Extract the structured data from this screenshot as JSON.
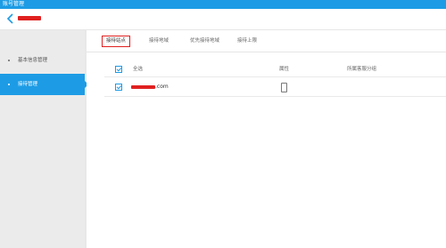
{
  "window": {
    "title": "账号管理"
  },
  "sidebar": {
    "items": [
      {
        "label": "基本信息管理"
      },
      {
        "label": "接待管理"
      }
    ]
  },
  "tabs": [
    {
      "label": "接待站点"
    },
    {
      "label": "接待地域"
    },
    {
      "label": "优先接待地域"
    },
    {
      "label": "接待上限"
    }
  ],
  "table": {
    "headers": {
      "select_all": "全选",
      "attribute": "属性",
      "group": "所属客服分组"
    },
    "rows": [
      {
        "site_suffix": ".com",
        "attribute_icon": "mobile-phone-icon",
        "group": ""
      }
    ]
  },
  "colors": {
    "accent": "#1d9ce5",
    "highlight": "#e02020"
  }
}
